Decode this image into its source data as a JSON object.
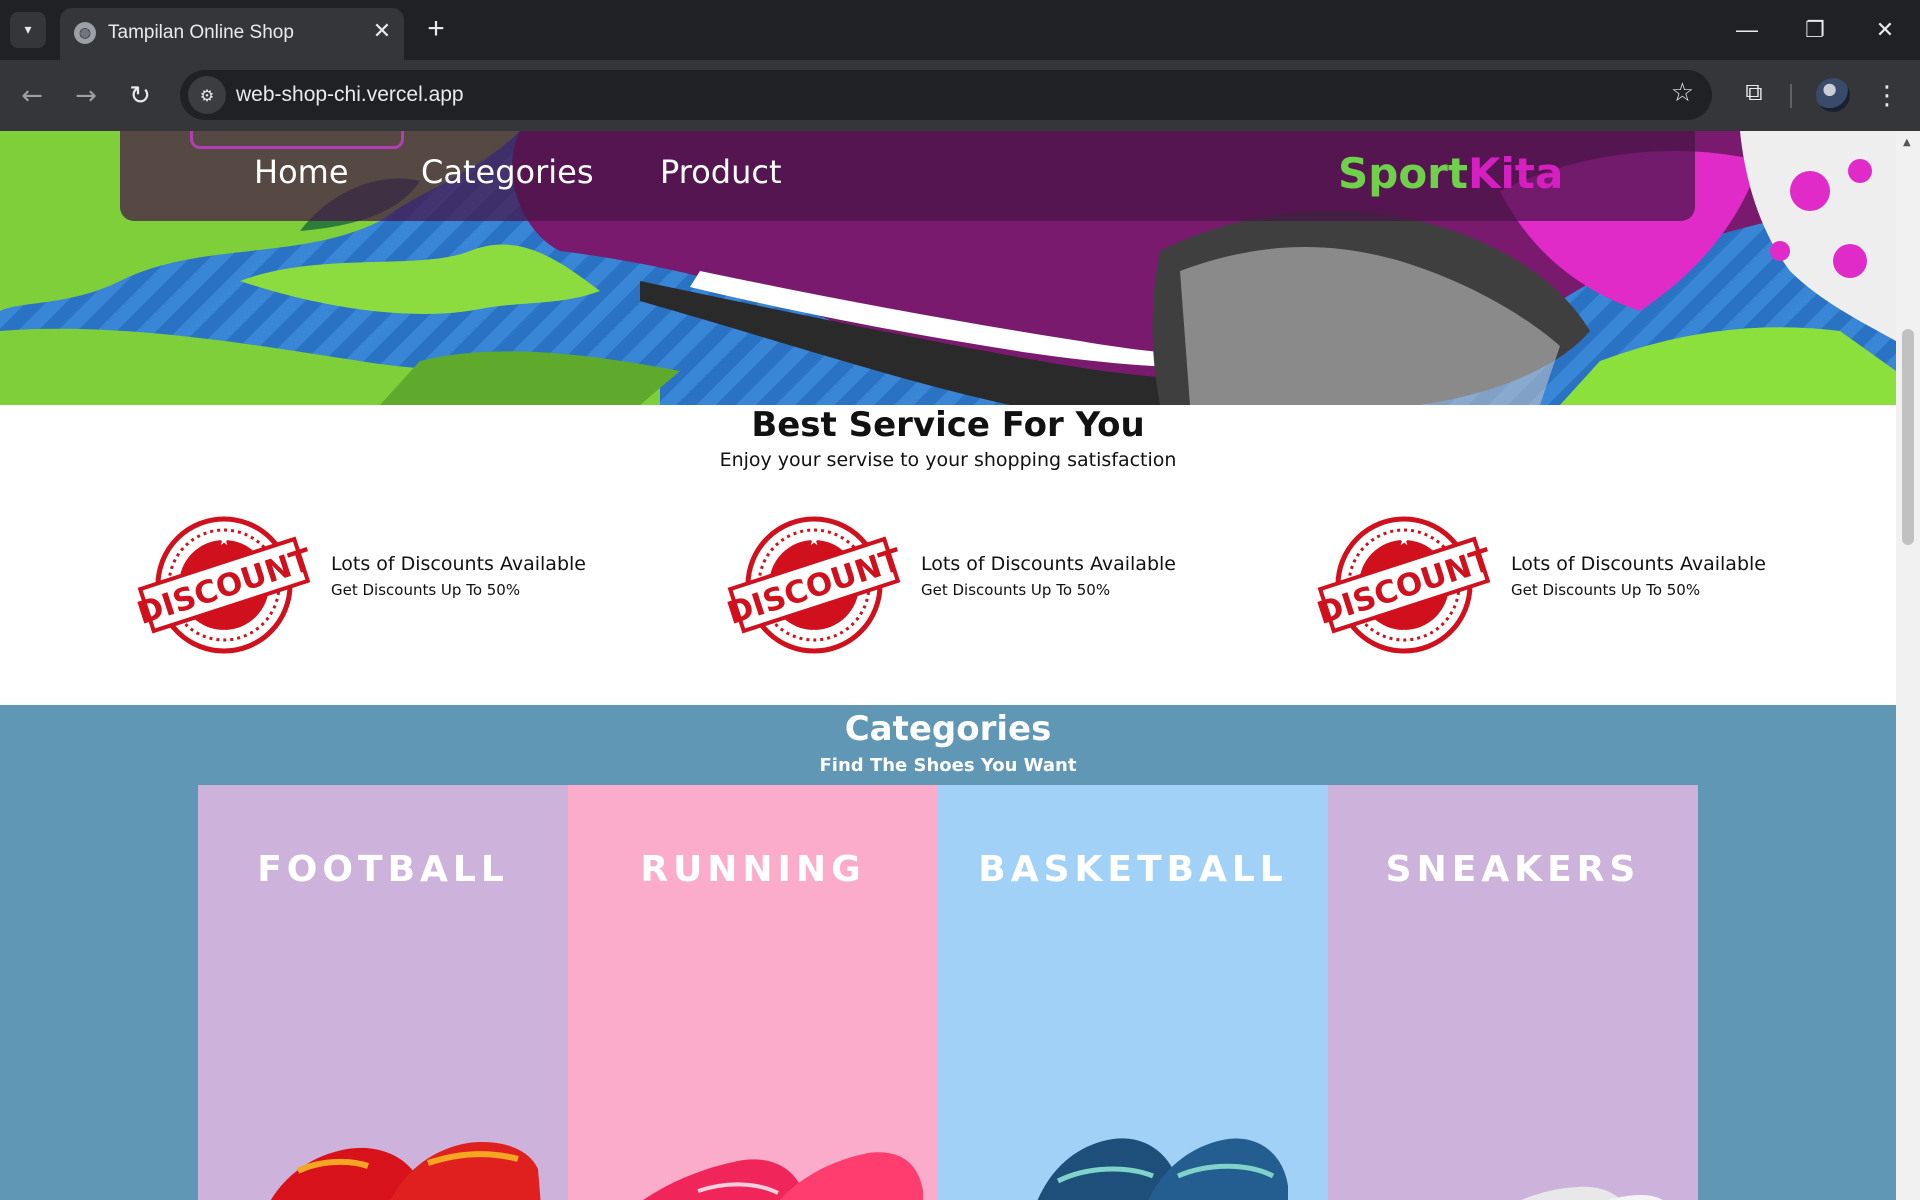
{
  "browser": {
    "tab_title": "Tampilan Online Shop",
    "url": "web-shop-chi.vercel.app",
    "tab_close": "✕",
    "new_tab": "+"
  },
  "nav": {
    "links": [
      "Home",
      "Categories",
      "Product"
    ],
    "brand_part1": "Sport",
    "brand_part2": "Kita"
  },
  "services": {
    "title": "Best Service For You",
    "subtitle": "Enjoy your servise to your shopping satisfaction",
    "stamp_text": "DISCOUNT",
    "items": [
      {
        "title": "Lots of Discounts Available",
        "desc": "Get Discounts Up To 50%"
      },
      {
        "title": "Lots of Discounts Available",
        "desc": "Get Discounts Up To 50%"
      },
      {
        "title": "Lots of Discounts Available",
        "desc": "Get Discounts Up To 50%"
      }
    ]
  },
  "categories": {
    "title": "Categories",
    "subtitle": "Find The Shoes You Want",
    "items": [
      {
        "label": "FOOTBALL",
        "color": "#cdb3db",
        "shoe_color": "#d8121a"
      },
      {
        "label": "RUNNING",
        "color": "#fcaccb",
        "shoe_color": "#f0265a"
      },
      {
        "label": "BASKETBALL",
        "color": "#a2d1f8",
        "shoe_color": "#1e4f7a"
      },
      {
        "label": "SNEAKERS",
        "color": "#cdb3db",
        "shoe_color": "#e8e8ea"
      }
    ]
  },
  "colors": {
    "brand_green": "#6fd04a",
    "brand_magenta": "#d61fc0",
    "categories_bg": "#6097b5",
    "stamp_red": "#d0101c"
  },
  "icons": {
    "tab_search": "chevron-down-icon",
    "favicon": "globe-icon",
    "back": "arrow-left-icon",
    "forward": "arrow-right-icon",
    "reload": "reload-icon",
    "site_info": "tune-icon",
    "bookmark": "star-icon",
    "extensions": "puzzle-icon",
    "menu": "kebab-menu-icon"
  }
}
